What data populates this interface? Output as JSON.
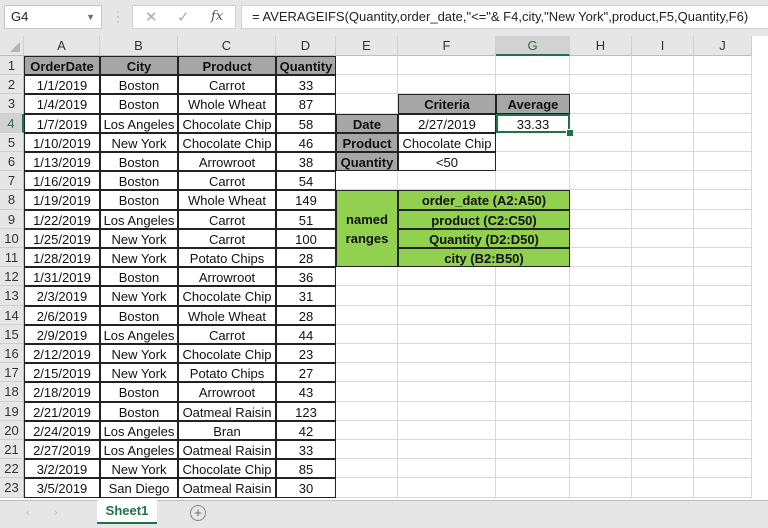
{
  "formula_bar": {
    "name_box": "G4",
    "cancel_icon": "✕",
    "enter_icon": "✓",
    "fx_icon": "fx",
    "formula": "= AVERAGEIFS(Quantity,order_date,\"<=\"& F4,city,\"New York\",product,F5,Quantity,F6)"
  },
  "columns": [
    "A",
    "B",
    "C",
    "D",
    "E",
    "F",
    "G",
    "H",
    "I",
    "J"
  ],
  "selected_column": "G",
  "selected_row": 4,
  "rows": [
    "1",
    "2",
    "3",
    "4",
    "5",
    "6",
    "7",
    "8",
    "9",
    "10",
    "11",
    "12",
    "13",
    "14",
    "15",
    "16",
    "17",
    "18",
    "19",
    "20",
    "21",
    "22",
    "23"
  ],
  "table": {
    "headers": [
      "OrderDate",
      "City",
      "Product",
      "Quantity"
    ],
    "data": [
      [
        "1/1/2019",
        "Boston",
        "Carrot",
        "33"
      ],
      [
        "1/4/2019",
        "Boston",
        "Whole Wheat",
        "87"
      ],
      [
        "1/7/2019",
        "Los Angeles",
        "Chocolate Chip",
        "58"
      ],
      [
        "1/10/2019",
        "New York",
        "Chocolate Chip",
        "46"
      ],
      [
        "1/13/2019",
        "Boston",
        "Arrowroot",
        "38"
      ],
      [
        "1/16/2019",
        "Boston",
        "Carrot",
        "54"
      ],
      [
        "1/19/2019",
        "Boston",
        "Whole Wheat",
        "149"
      ],
      [
        "1/22/2019",
        "Los Angeles",
        "Carrot",
        "51"
      ],
      [
        "1/25/2019",
        "New York",
        "Carrot",
        "100"
      ],
      [
        "1/28/2019",
        "New York",
        "Potato Chips",
        "28"
      ],
      [
        "1/31/2019",
        "Boston",
        "Arrowroot",
        "36"
      ],
      [
        "2/3/2019",
        "New York",
        "Chocolate Chip",
        "31"
      ],
      [
        "2/6/2019",
        "Boston",
        "Whole Wheat",
        "28"
      ],
      [
        "2/9/2019",
        "Los Angeles",
        "Carrot",
        "44"
      ],
      [
        "2/12/2019",
        "New York",
        "Chocolate Chip",
        "23"
      ],
      [
        "2/15/2019",
        "New York",
        "Potato Chips",
        "27"
      ],
      [
        "2/18/2019",
        "Boston",
        "Arrowroot",
        "43"
      ],
      [
        "2/21/2019",
        "Boston",
        "Oatmeal Raisin",
        "123"
      ],
      [
        "2/24/2019",
        "Los Angeles",
        "Bran",
        "42"
      ],
      [
        "2/27/2019",
        "Los Angeles",
        "Oatmeal Raisin",
        "33"
      ],
      [
        "3/2/2019",
        "New York",
        "Chocolate Chip",
        "85"
      ],
      [
        "3/5/2019",
        "San Diego",
        "Oatmeal Raisin",
        "30"
      ]
    ]
  },
  "criteria": {
    "criteria_header": "Criteria",
    "average_header": "Average",
    "labels": [
      "Date",
      "Product",
      "Quantity"
    ],
    "values": [
      "2/27/2019",
      "Chocolate Chip",
      "<50"
    ],
    "average_value": "33.33"
  },
  "named_ranges": {
    "label_line1": "named",
    "label_line2": "ranges",
    "items": [
      "order_date (A2:A50)",
      "product (C2:C50)",
      "Quantity (D2:D50)",
      "city (B2:B50)"
    ]
  },
  "sheet_tabs": {
    "prev_icon": "‹",
    "next_icon": "›",
    "active_tab": "Sheet1",
    "add_icon": "+"
  },
  "colors": {
    "accent": "#217346",
    "header_fill": "#a6a6a6",
    "named_range_fill": "#92d050"
  }
}
